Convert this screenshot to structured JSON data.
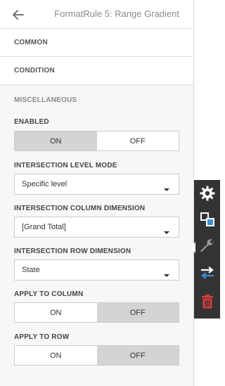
{
  "header": {
    "title": "FormatRule 5: Range Gradient",
    "back_icon": "arrow-left-icon"
  },
  "sections": {
    "common": "COMMON",
    "condition": "CONDITION"
  },
  "misc": {
    "title": "MISCELLANEOUS",
    "enabled": {
      "label": "ENABLED",
      "on": "ON",
      "off": "OFF",
      "selected": "ON"
    },
    "intersection_level_mode": {
      "label": "INTERSECTION LEVEL MODE",
      "value": "Specific level"
    },
    "intersection_column_dimension": {
      "label": "INTERSECTION COLUMN DIMENSION",
      "value": "[Grand Total]"
    },
    "intersection_row_dimension": {
      "label": "INTERSECTION ROW DIMENSION",
      "value": "State"
    },
    "apply_to_column": {
      "label": "APPLY TO COLUMN",
      "on": "ON",
      "off": "OFF",
      "selected": "OFF"
    },
    "apply_to_row": {
      "label": "APPLY TO ROW",
      "on": "ON",
      "off": "OFF",
      "selected": "OFF"
    }
  },
  "toolbar": {
    "items": [
      "gear-icon",
      "layers-icon",
      "wrench-icon",
      "swap-arrows-icon",
      "trash-icon"
    ],
    "colors": {
      "background": "#333333",
      "icon": "#ffffff",
      "accent": "#3d8fd6",
      "danger": "#d93a3a",
      "wrench_active": "#9a9a9a"
    }
  }
}
